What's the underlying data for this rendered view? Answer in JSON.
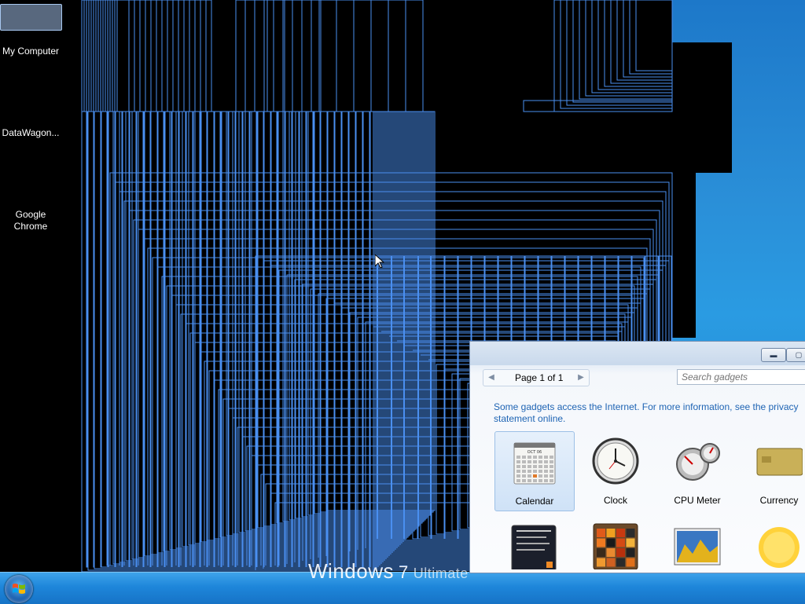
{
  "desktop": {
    "icons": [
      {
        "label": "My Computer"
      },
      {
        "label": "DataWagon..."
      },
      {
        "label": "Google Chrome"
      }
    ]
  },
  "taskbar": {
    "brand": "Windows",
    "brand_version": "7",
    "brand_edition": "Ultimate"
  },
  "gadget_gallery": {
    "pager_label": "Page 1 of 1",
    "search_placeholder": "Search gadgets",
    "notice": "Some gadgets access the Internet.  For more information, see the privacy statement online.",
    "gadgets_row1": [
      {
        "label": "Calendar",
        "icon": "calendar-icon",
        "selected": true
      },
      {
        "label": "Clock",
        "icon": "clock-icon"
      },
      {
        "label": "CPU Meter",
        "icon": "cpu-meter-icon"
      },
      {
        "label": "Currency",
        "icon": "currency-icon"
      }
    ],
    "gadgets_row2": [
      {
        "icon": "feed-headlines-icon"
      },
      {
        "icon": "picture-puzzle-icon"
      },
      {
        "icon": "slide-show-icon"
      },
      {
        "icon": "weather-icon"
      }
    ],
    "calendar_month": "OCT 06"
  },
  "colors": {
    "wallpaper": "#2a8fd8",
    "glitch_line": "#4a8ff0",
    "link": "#1e64b4"
  }
}
